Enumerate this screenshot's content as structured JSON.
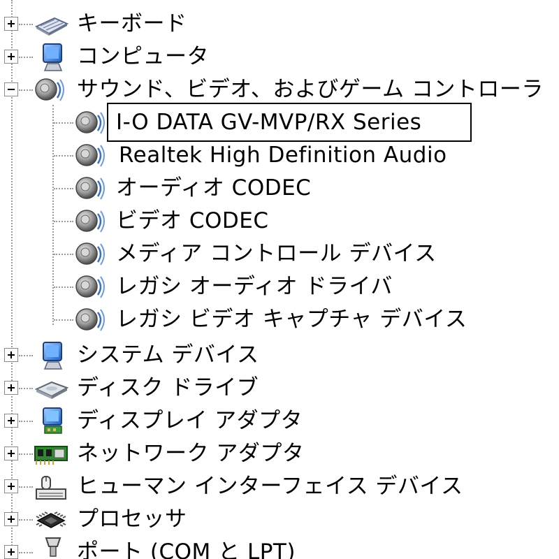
{
  "tree": {
    "top_categories": [
      {
        "label": "キーボード",
        "icon": "keyboard-icon",
        "expanded": false
      },
      {
        "label": "コンピュータ",
        "icon": "computer-icon",
        "expanded": false
      },
      {
        "label": "サウンド、ビデオ、およびゲーム コントローラ",
        "icon": "speaker-icon",
        "expanded": true
      }
    ],
    "sound_children": [
      {
        "label": "I-O DATA GV-MVP/RX Series",
        "icon": "speaker-icon",
        "selected": true
      },
      {
        "label": "Realtek High Definition Audio",
        "icon": "speaker-icon",
        "selected": false
      },
      {
        "label": "オーディオ CODEC",
        "icon": "speaker-icon",
        "selected": false
      },
      {
        "label": "ビデオ CODEC",
        "icon": "speaker-icon",
        "selected": false
      },
      {
        "label": "メディア コントロール デバイス",
        "icon": "speaker-icon",
        "selected": false
      },
      {
        "label": "レガシ オーディオ ドライバ",
        "icon": "speaker-icon",
        "selected": false
      },
      {
        "label": "レガシ ビデオ キャプチャ デバイス",
        "icon": "speaker-icon",
        "selected": false
      }
    ],
    "bottom_categories": [
      {
        "label": "システム デバイス",
        "icon": "system-device-icon",
        "expanded": false
      },
      {
        "label": "ディスク ドライブ",
        "icon": "disk-drive-icon",
        "expanded": false
      },
      {
        "label": "ディスプレイ アダプタ",
        "icon": "display-adapter-icon",
        "expanded": false
      },
      {
        "label": "ネットワーク アダプタ",
        "icon": "network-adapter-icon",
        "expanded": false
      },
      {
        "label": "ヒューマン インターフェイス デバイス",
        "icon": "hid-icon",
        "expanded": false
      },
      {
        "label": "プロセッサ",
        "icon": "processor-icon",
        "expanded": false
      },
      {
        "label": "ポート (COM と LPT)",
        "icon": "port-icon",
        "expanded": false
      }
    ]
  },
  "colors": {
    "tree_line": "#9a9a9a",
    "selection_border": "#000000",
    "monitor_blue": "#3a78d8",
    "network_green": "#2f8a2f"
  }
}
